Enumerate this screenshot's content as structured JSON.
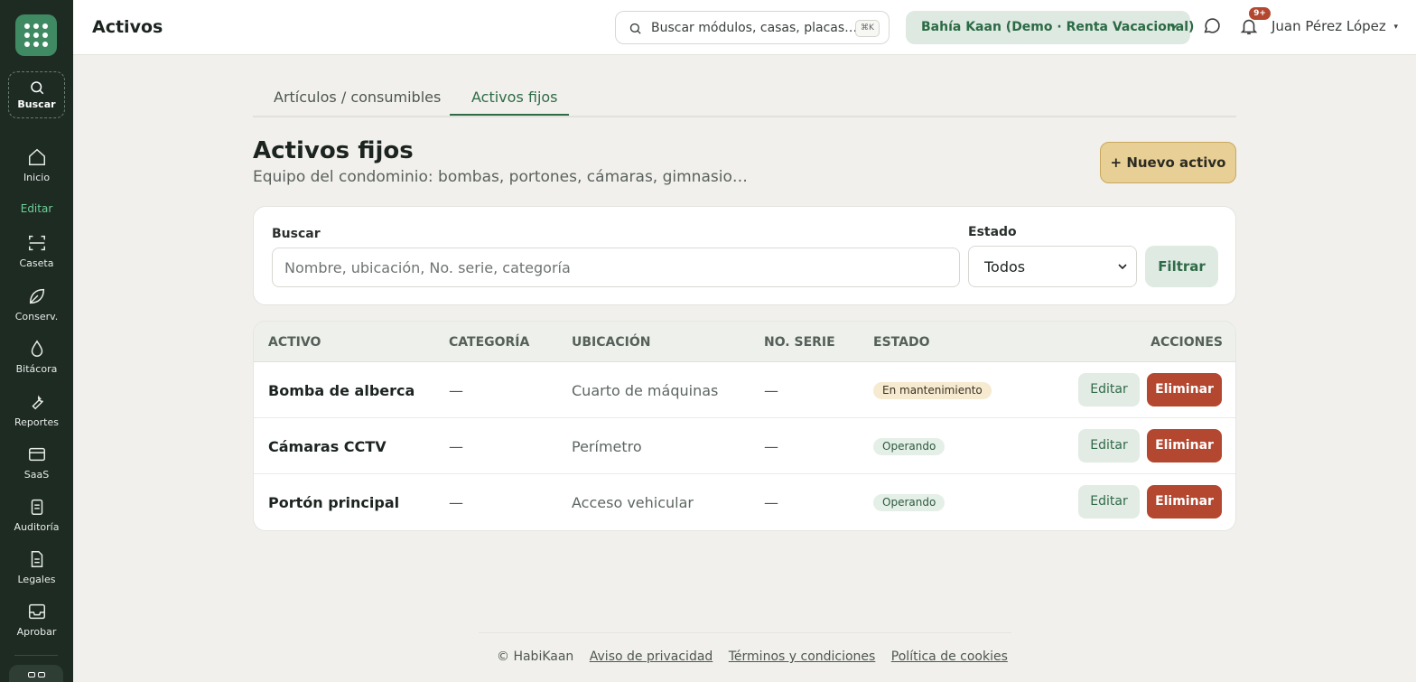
{
  "sidebar": {
    "search_label": "Buscar",
    "section_label": "Editar",
    "items": [
      {
        "label": "Inicio",
        "icon": "home-icon"
      },
      {
        "label": "Caseta",
        "icon": "scan-icon"
      },
      {
        "label": "Conserv.",
        "icon": "leaf-icon"
      },
      {
        "label": "Bitácora",
        "icon": "drop-icon"
      },
      {
        "label": "Reportes",
        "icon": "wrench-icon"
      },
      {
        "label": "SaaS",
        "icon": "card-icon"
      },
      {
        "label": "Auditoría",
        "icon": "clipboard-icon"
      },
      {
        "label": "Legales",
        "icon": "document-icon"
      },
      {
        "label": "Aprobar",
        "icon": "inbox-icon"
      }
    ]
  },
  "header": {
    "title": "Activos",
    "search_placeholder": "Buscar módulos, casas, placas…",
    "shortcut": "⌘K",
    "tenant": "Bahía Kaan (Demo · Renta Vacacional)",
    "notifications": "9+",
    "user": "Juan Pérez López",
    "user_caret": "▾"
  },
  "tabs": [
    {
      "label": "Artículos / consumibles",
      "active": false
    },
    {
      "label": "Activos fijos",
      "active": true
    }
  ],
  "section": {
    "title": "Activos fijos",
    "subtitle": "Equipo del condominio: bombas, portones, cámaras, gimnasio…",
    "new_button": "+ Nuevo activo"
  },
  "filters": {
    "search_label": "Buscar",
    "search_placeholder": "Nombre, ubicación, No. serie, categoría",
    "status_label": "Estado",
    "status_value": "Todos",
    "filter_button": "Filtrar"
  },
  "table": {
    "columns": [
      "ACTIVO",
      "CATEGORÍA",
      "UBICACIÓN",
      "NO. SERIE",
      "ESTADO",
      "ACCIONES"
    ],
    "rows": [
      {
        "name": "Bomba de alberca",
        "category": "—",
        "location": "Cuarto de máquinas",
        "serial": "—",
        "status": "En mantenimiento",
        "status_kind": "maint"
      },
      {
        "name": "Cámaras CCTV",
        "category": "—",
        "location": "Perímetro",
        "serial": "—",
        "status": "Operando",
        "status_kind": "ok"
      },
      {
        "name": "Portón principal",
        "category": "—",
        "location": "Acceso vehicular",
        "serial": "—",
        "status": "Operando",
        "status_kind": "ok"
      }
    ],
    "edit_label": "Editar",
    "delete_label": "Eliminar"
  },
  "footer": {
    "copyright": "© HabiKaan",
    "links": [
      "Aviso de privacidad",
      "Términos y condiciones",
      "Política de cookies"
    ]
  },
  "colors": {
    "sidebar_bg": "#1d2b23",
    "brand_green": "#2f6b47",
    "accent_gold": "#e8cf96",
    "danger": "#b4472f",
    "page_bg": "#f1f0ec"
  }
}
